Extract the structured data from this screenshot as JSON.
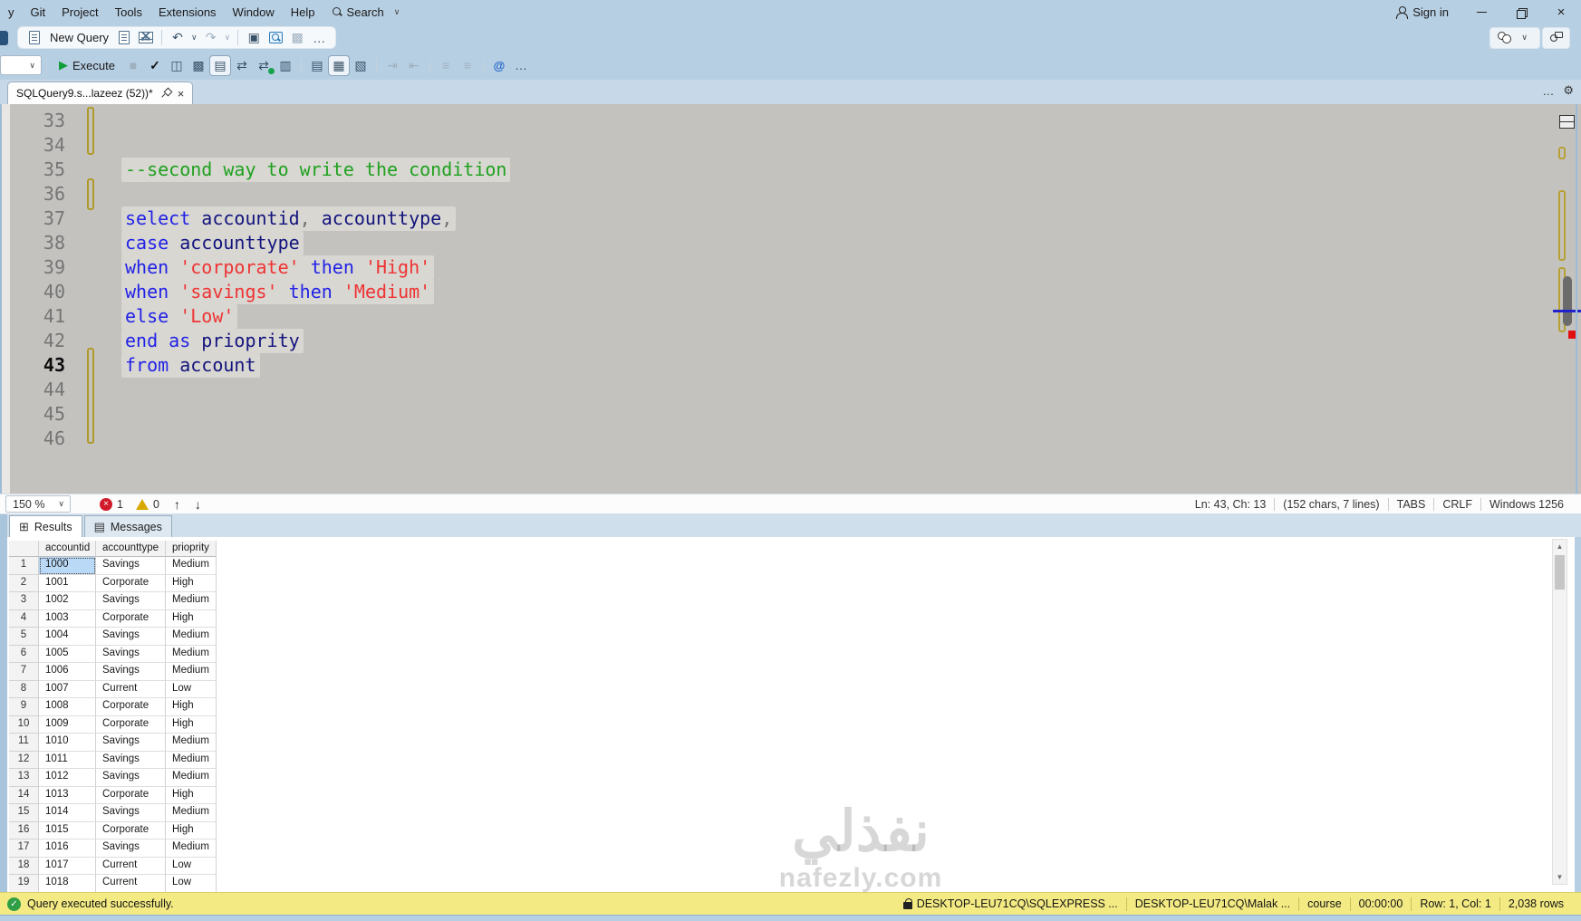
{
  "titlebar": {
    "menus": [
      "y",
      "Git",
      "Project",
      "Tools",
      "Extensions",
      "Window",
      "Help"
    ],
    "search_label": "Search",
    "sign_in": "Sign in"
  },
  "toolbar_main": {
    "new_query": "New Query"
  },
  "toolbar_query": {
    "execute": "Execute"
  },
  "icons": {
    "play": "▶",
    "stop": "■",
    "check": "✓",
    "undo": "↶",
    "redo": "↷",
    "chevron": "∨",
    "up": "↑",
    "down": "↓",
    "gear": "⚙",
    "ellipsis": "…",
    "grid": "⊞",
    "doc": "▤",
    "doc2": "▥",
    "doc3": "▧",
    "showplan": "◫",
    "stack": "▩",
    "gridbig": "▦",
    "swap": "⇄",
    "indent1": "⇥",
    "indent2": "⇤",
    "lines": "≡",
    "at": "@",
    "square": "▣"
  },
  "tab": {
    "title": "SQLQuery9.s...lazeez (52))*"
  },
  "editor": {
    "zoom": "150 %",
    "error_count": "1",
    "warning_count": "0",
    "current_line": "43",
    "lines": [
      {
        "n": "33",
        "code": []
      },
      {
        "n": "34",
        "code": []
      },
      {
        "n": "35",
        "code": [
          {
            "c": "comment",
            "t": "--second way to write the condition"
          }
        ]
      },
      {
        "n": "36",
        "code": []
      },
      {
        "n": "37",
        "code": [
          {
            "c": "kw",
            "t": "select"
          },
          {
            "c": "op",
            "t": " "
          },
          {
            "c": "id",
            "t": "accountid"
          },
          {
            "c": "op",
            "t": ", "
          },
          {
            "c": "id",
            "t": "accounttype"
          },
          {
            "c": "op",
            "t": ","
          }
        ]
      },
      {
        "n": "38",
        "code": [
          {
            "c": "kw",
            "t": "case"
          },
          {
            "c": "op",
            "t": " "
          },
          {
            "c": "id",
            "t": "accounttype"
          }
        ]
      },
      {
        "n": "39",
        "code": [
          {
            "c": "kw",
            "t": "when"
          },
          {
            "c": "op",
            "t": " "
          },
          {
            "c": "str",
            "t": "'corporate'"
          },
          {
            "c": "kw",
            "t": " then"
          },
          {
            "c": "op",
            "t": " "
          },
          {
            "c": "str",
            "t": "'High'"
          }
        ]
      },
      {
        "n": "40",
        "code": [
          {
            "c": "kw",
            "t": "when"
          },
          {
            "c": "op",
            "t": " "
          },
          {
            "c": "str",
            "t": "'savings'"
          },
          {
            "c": "kw",
            "t": " then"
          },
          {
            "c": "op",
            "t": " "
          },
          {
            "c": "str",
            "t": "'Medium'"
          }
        ]
      },
      {
        "n": "41",
        "code": [
          {
            "c": "kw",
            "t": "else"
          },
          {
            "c": "op",
            "t": " "
          },
          {
            "c": "str",
            "t": "'Low'"
          }
        ]
      },
      {
        "n": "42",
        "code": [
          {
            "c": "kw",
            "t": "end as"
          },
          {
            "c": "op",
            "t": " "
          },
          {
            "c": "id",
            "t": "prioprity"
          }
        ]
      },
      {
        "n": "43",
        "code": [
          {
            "c": "kw",
            "t": "from"
          },
          {
            "c": "op",
            "t": " "
          },
          {
            "c": "id",
            "t": "account"
          }
        ]
      },
      {
        "n": "44",
        "code": []
      },
      {
        "n": "45",
        "code": []
      },
      {
        "n": "46",
        "code": []
      }
    ]
  },
  "editor_status": {
    "segments": [
      "Ln: 43, Ch: 13",
      "(152 chars, 7 lines)",
      "TABS",
      "CRLF",
      "Windows 1256"
    ]
  },
  "results_panel": {
    "tabs": [
      "Results",
      "Messages"
    ]
  },
  "grid": {
    "columns": [
      "accountid",
      "accounttype",
      "prioprity"
    ],
    "selected": {
      "row": 0,
      "col": 0
    },
    "rows": [
      [
        "1000",
        "Savings",
        "Medium"
      ],
      [
        "1001",
        "Corporate",
        "High"
      ],
      [
        "1002",
        "Savings",
        "Medium"
      ],
      [
        "1003",
        "Corporate",
        "High"
      ],
      [
        "1004",
        "Savings",
        "Medium"
      ],
      [
        "1005",
        "Savings",
        "Medium"
      ],
      [
        "1006",
        "Savings",
        "Medium"
      ],
      [
        "1007",
        "Current",
        "Low"
      ],
      [
        "1008",
        "Corporate",
        "High"
      ],
      [
        "1009",
        "Corporate",
        "High"
      ],
      [
        "1010",
        "Savings",
        "Medium"
      ],
      [
        "1011",
        "Savings",
        "Medium"
      ],
      [
        "1012",
        "Savings",
        "Medium"
      ],
      [
        "1013",
        "Corporate",
        "High"
      ],
      [
        "1014",
        "Savings",
        "Medium"
      ],
      [
        "1015",
        "Corporate",
        "High"
      ],
      [
        "1016",
        "Savings",
        "Medium"
      ],
      [
        "1017",
        "Current",
        "Low"
      ],
      [
        "1018",
        "Current",
        "Low"
      ]
    ]
  },
  "statusbar": {
    "message": "Query executed successfully.",
    "segments": [
      "DESKTOP-LEU71CQ\\SQLEXPRESS ...",
      "DESKTOP-LEU71CQ\\Malak ...",
      "course",
      "00:00:00",
      "Row: 1, Col: 1",
      "2,038 rows"
    ]
  },
  "watermark": {
    "arabic": "نفذلي",
    "latin": "nafezly.com"
  },
  "colors": {
    "accent": "#b7cfe3",
    "keyword": "#2222e6",
    "string": "#ef3333",
    "comment": "#1ea11e",
    "identifier": "#13137d",
    "error": "#d11a2a",
    "success": "#2f9e44",
    "statusbar_bg": "#f3ea83"
  }
}
